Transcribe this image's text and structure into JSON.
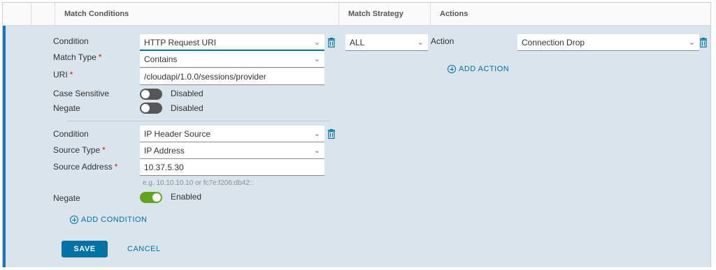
{
  "header": {
    "match_conditions": "Match Conditions",
    "match_strategy": "Match Strategy",
    "actions": "Actions"
  },
  "conditions": [
    {
      "condition_label": "Condition",
      "condition_value": "HTTP Request URI",
      "match_type_label": "Match Type",
      "match_type_value": "Contains",
      "uri_label": "URI",
      "uri_value": "/cloudapi/1.0.0/sessions/provider",
      "case_sensitive_label": "Case Sensitive",
      "case_sensitive_state": "Disabled",
      "negate_label": "Negate",
      "negate_state": "Disabled"
    },
    {
      "condition_label": "Condition",
      "condition_value": "IP Header Source",
      "source_type_label": "Source Type",
      "source_type_value": "IP Address",
      "source_address_label": "Source Address",
      "source_address_value": "10.37.5.30",
      "source_address_hint": "e.g. 10.10.10.10 or fc7e:f206:db42::",
      "negate_label": "Negate",
      "negate_state": "Enabled"
    }
  ],
  "required_mark": "*",
  "strategy": {
    "value": "ALL"
  },
  "action": {
    "label": "Action",
    "value": "Connection Drop",
    "add_action": "ADD ACTION"
  },
  "add_condition": "ADD CONDITION",
  "buttons": {
    "save": "SAVE",
    "cancel": "CANCEL"
  },
  "colors": {
    "accent": "#0072a3",
    "panel": "#d9e4ed",
    "toggle_on": "#62a420",
    "toggle_off": "#565656",
    "required": "#c92100"
  },
  "icons": {
    "delete": "trash-icon",
    "dropdown": "chevron-down-icon",
    "add": "plus-circle-icon"
  }
}
